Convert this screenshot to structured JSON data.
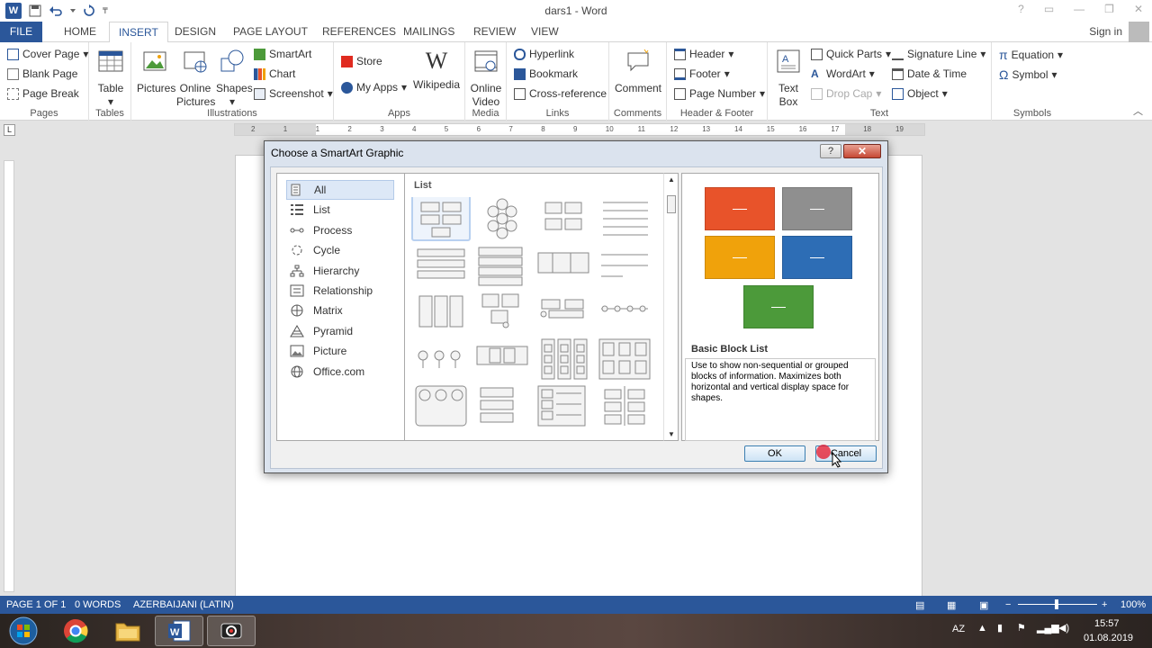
{
  "window": {
    "title": "dars1 - Word"
  },
  "tabs": {
    "file": "FILE",
    "home": "HOME",
    "insert": "INSERT",
    "design": "DESIGN",
    "page_layout": "PAGE LAYOUT",
    "references": "REFERENCES",
    "mailings": "MAILINGS",
    "review": "REVIEW",
    "view": "VIEW"
  },
  "account": {
    "sign_in": "Sign in"
  },
  "ribbon": {
    "pages": {
      "label": "Pages",
      "cover_page": "Cover Page",
      "blank_page": "Blank Page",
      "page_break": "Page Break"
    },
    "tables": {
      "label": "Tables",
      "table": "Table"
    },
    "illustrations": {
      "label": "Illustrations",
      "pictures": "Pictures",
      "online_pictures_1": "Online",
      "online_pictures_2": "Pictures",
      "shapes": "Shapes",
      "smartart": "SmartArt",
      "chart": "Chart",
      "screenshot": "Screenshot"
    },
    "apps": {
      "label": "Apps",
      "store": "Store",
      "my_apps": "My Apps",
      "wikipedia": "Wikipedia"
    },
    "media": {
      "label": "Media",
      "online_video_1": "Online",
      "online_video_2": "Video"
    },
    "links": {
      "label": "Links",
      "hyperlink": "Hyperlink",
      "bookmark": "Bookmark",
      "cross_reference": "Cross-reference"
    },
    "comments": {
      "label": "Comments",
      "comment": "Comment"
    },
    "header_footer": {
      "label": "Header & Footer",
      "header": "Header",
      "footer": "Footer",
      "page_number": "Page Number"
    },
    "text": {
      "label": "Text",
      "text_box_1": "Text",
      "text_box_2": "Box",
      "quick_parts": "Quick Parts",
      "wordart": "WordArt",
      "drop_cap": "Drop Cap",
      "signature_line": "Signature Line",
      "date_time": "Date & Time",
      "object": "Object"
    },
    "symbols": {
      "label": "Symbols",
      "equation": "Equation",
      "symbol": "Symbol"
    }
  },
  "ruler": {
    "ticks": [
      "2",
      "1",
      "1",
      "2",
      "3",
      "4",
      "5",
      "6",
      "7",
      "8",
      "9",
      "10",
      "11",
      "12",
      "13",
      "14",
      "15",
      "16",
      "17",
      "18",
      "19"
    ]
  },
  "dialog": {
    "title": "Choose a SmartArt Graphic",
    "help": "?",
    "close": "✕",
    "categories": [
      "All",
      "List",
      "Process",
      "Cycle",
      "Hierarchy",
      "Relationship",
      "Matrix",
      "Pyramid",
      "Picture",
      "Office.com"
    ],
    "selected_category": "All",
    "gallery_heading": "List",
    "preview": {
      "name": "Basic Block List",
      "description": "Use to show non-sequential or grouped blocks of information. Maximizes both horizontal and vertical display space for shapes.",
      "block_colors": [
        "#e8532a",
        "#8f8f8f",
        "#f0a20b",
        "#2d6db5",
        "#4c9a3a"
      ]
    },
    "ok": "OK",
    "cancel": "Cancel"
  },
  "statusbar": {
    "page": "PAGE 1 OF 1",
    "words": "0 WORDS",
    "language": "AZERBAIJANI (LATIN)",
    "zoom": "100%"
  },
  "taskbar": {
    "input_lang": "AZ",
    "time": "15:57",
    "date": "01.08.2019"
  },
  "colors": {
    "word_blue": "#2b579a",
    "accent_red": "#c64834"
  }
}
